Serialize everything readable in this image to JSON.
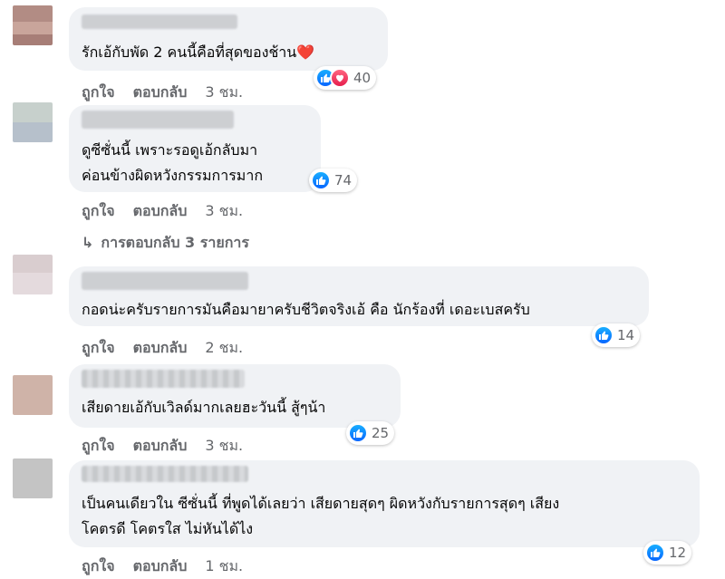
{
  "comments": [
    {
      "text_lines": [
        "รักเอ้กับพัด 2 คนนี้คือที่สุดของช้าน❤️"
      ],
      "reactions": {
        "icons": [
          "like-icon",
          "love-icon"
        ],
        "count": "40"
      },
      "like_label": "ถูกใจ",
      "reply_label": "ตอบกลับ",
      "time": "3 ชม."
    },
    {
      "text_lines": [
        "ดูซีซั่นนี้ เพราะรอดูเอ้กลับมา",
        "ค่อนข้างผิดหวังกรรมการมาก"
      ],
      "reactions": {
        "icons": [
          "like-icon"
        ],
        "count": "74"
      },
      "like_label": "ถูกใจ",
      "reply_label": "ตอบกลับ",
      "time": "3 ชม."
    },
    {
      "text_lines": [
        "กอดน่ะครับรายการมันคือมายาครับชีวิตจริงเอ้ คือ นักร้องที่ เดอะเบสครับ"
      ],
      "reactions": {
        "icons": [
          "like-icon"
        ],
        "count": "14"
      },
      "like_label": "ถูกใจ",
      "reply_label": "ตอบกลับ",
      "time": "2 ชม."
    },
    {
      "text_lines": [
        "เสียดายเอ้กับเวิลด์มากเลยฮะวันนี้ สู้ๆน้า"
      ],
      "reactions": {
        "icons": [
          "like-icon"
        ],
        "count": "25"
      },
      "like_label": "ถูกใจ",
      "reply_label": "ตอบกลับ",
      "time": "3 ชม."
    },
    {
      "text_lines": [
        "เป็นคนเดียวใน ซีซั่นนี้ ที่พูดได้เลยว่า เสียดายสุดๆ ผิดหวังกับรายการสุดๆ เสียง",
        "โคตรดี โคตรใส ไม่หันได้ไง"
      ],
      "reactions": {
        "icons": [
          "like-icon"
        ],
        "count": "12"
      },
      "like_label": "ถูกใจ",
      "reply_label": "ตอบกลับ",
      "time": "1 ชม."
    }
  ],
  "replies_link": {
    "icon": "reply-arrow-icon",
    "label": "การตอบกลับ 3 รายการ"
  },
  "colors": {
    "bubble": "#f0f2f5",
    "secondary_text": "#65676b",
    "like_blue": "#0866ff",
    "love_red": "#e61e4d"
  }
}
